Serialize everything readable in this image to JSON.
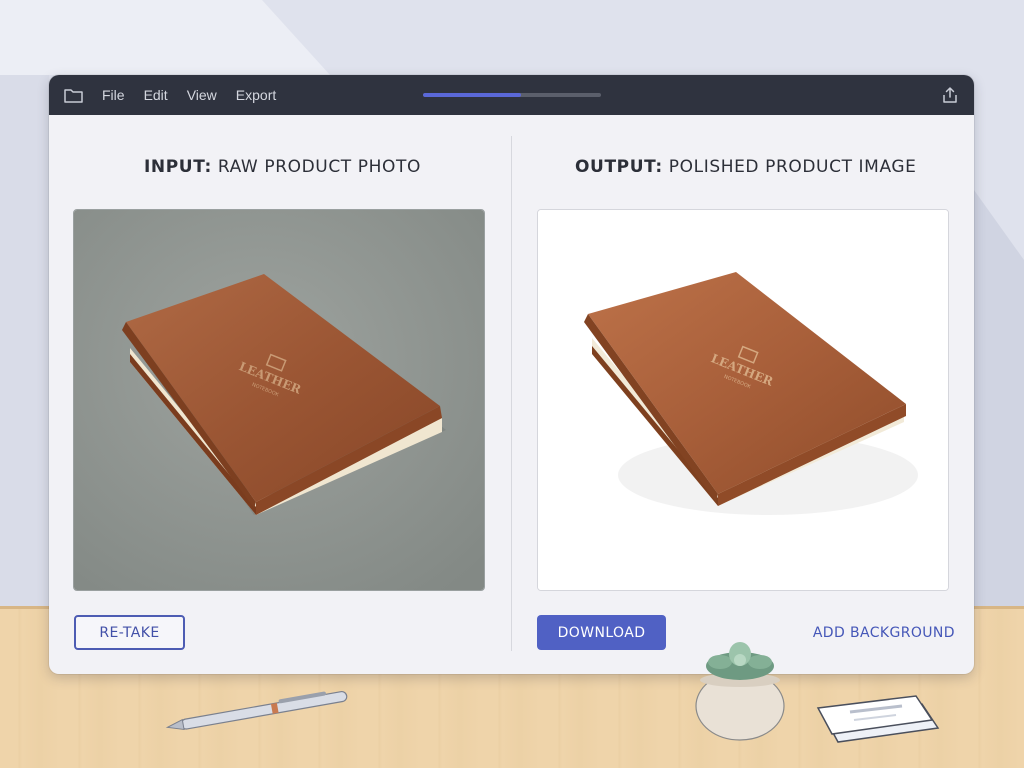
{
  "window": {
    "menu": [
      "File",
      "Edit",
      "View",
      "Export"
    ],
    "progress": 0.55,
    "accent_color": "#5061c4",
    "icons": {
      "left": "folder-icon",
      "right": "share-icon"
    }
  },
  "input_panel": {
    "title_prefix": "INPUT:",
    "title_text": "RAW PRODUCT PHOTO",
    "image": "leather-notebook-on-gray-background",
    "action_label": "RE-TAKE"
  },
  "output_panel": {
    "title_prefix": "OUTPUT:",
    "title_text": "POLISHED PRODUCT IMAGE",
    "image": "leather-notebook-on-white-background",
    "primary_action_label": "DOWNLOAD",
    "secondary_action_label": "ADD BACKGROUND"
  },
  "notebook": {
    "emboss_title": "LEATHER",
    "emboss_subtitle": "NOTEBOOK"
  },
  "desk_items": [
    "pen",
    "succulent-plant",
    "business-cards"
  ]
}
